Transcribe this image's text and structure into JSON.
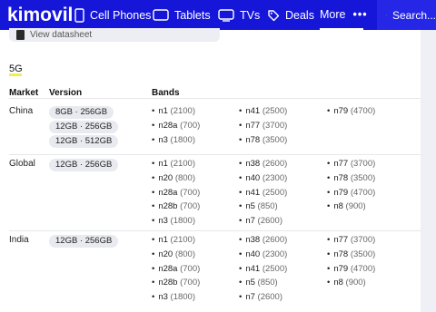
{
  "nav": {
    "logo": "kimovil",
    "items": [
      {
        "label": "Cell Phones",
        "icon": "phone-icon"
      },
      {
        "label": "Tablets",
        "icon": "tablet-icon"
      },
      {
        "label": "TVs",
        "icon": "tv-icon"
      },
      {
        "label": "Deals",
        "icon": "tag-icon"
      }
    ],
    "more_label": "More",
    "more_dots": "•••",
    "search_label": "Search..."
  },
  "datasheet_link": "View datasheet",
  "section_title": "5G",
  "table": {
    "headers": {
      "market": "Market",
      "version": "Version",
      "bands": "Bands"
    },
    "rows": [
      {
        "market": "China",
        "versions": [
          "8GB · 256GB",
          "12GB · 256GB",
          "12GB · 512GB"
        ],
        "bands": [
          [
            "n1",
            "(2100)"
          ],
          [
            "n28a",
            "(700)"
          ],
          [
            "n3",
            "(1800)"
          ],
          [
            "n41",
            "(2500)"
          ],
          [
            "n77",
            "(3700)"
          ],
          [
            "n78",
            "(3500)"
          ],
          [
            "n79",
            "(4700)"
          ]
        ]
      },
      {
        "market": "Global",
        "versions": [
          "12GB · 256GB"
        ],
        "bands": [
          [
            "n1",
            "(2100)"
          ],
          [
            "n20",
            "(800)"
          ],
          [
            "n28a",
            "(700)"
          ],
          [
            "n28b",
            "(700)"
          ],
          [
            "n3",
            "(1800)"
          ],
          [
            "n38",
            "(2600)"
          ],
          [
            "n40",
            "(2300)"
          ],
          [
            "n41",
            "(2500)"
          ],
          [
            "n5",
            "(850)"
          ],
          [
            "n7",
            "(2600)"
          ],
          [
            "n77",
            "(3700)"
          ],
          [
            "n78",
            "(3500)"
          ],
          [
            "n79",
            "(4700)"
          ],
          [
            "n8",
            "(900)"
          ]
        ]
      },
      {
        "market": "India",
        "versions": [
          "12GB · 256GB"
        ],
        "bands": [
          [
            "n1",
            "(2100)"
          ],
          [
            "n20",
            "(800)"
          ],
          [
            "n28a",
            "(700)"
          ],
          [
            "n28b",
            "(700)"
          ],
          [
            "n3",
            "(1800)"
          ],
          [
            "n38",
            "(2600)"
          ],
          [
            "n40",
            "(2300)"
          ],
          [
            "n41",
            "(2500)"
          ],
          [
            "n5",
            "(850)"
          ],
          [
            "n7",
            "(2600)"
          ],
          [
            "n77",
            "(3700)"
          ],
          [
            "n78",
            "(3500)"
          ],
          [
            "n79",
            "(4700)"
          ],
          [
            "n8",
            "(900)"
          ]
        ]
      }
    ]
  }
}
